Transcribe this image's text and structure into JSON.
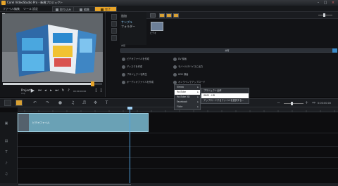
{
  "window": {
    "title": "Corel VideoStudio Pro - 新規プロジェクト"
  },
  "menubar": {
    "items": [
      "ファイル",
      "編集",
      "ツール",
      "設定"
    ]
  },
  "tabs": [
    {
      "label": "取り込み",
      "active": false
    },
    {
      "label": "編集",
      "active": false
    },
    {
      "label": "完了",
      "active": true
    }
  ],
  "player": {
    "project_label": "Project",
    "clip_label": "Clip",
    "timecode": "00:00:00:00"
  },
  "library": {
    "add_label": "追加",
    "nav_items": [
      "サンプル",
      "フォルダー"
    ],
    "thumb_label": "ビデオ",
    "path_label": "参照"
  },
  "share": {
    "header": "共有",
    "options": [
      "ビデオファイルを作成",
      "ディスクを作成",
      "プロジェクトを再生",
      "オーディオファイルを作成",
      "DV 録画",
      "モバイルデバイスに出力",
      "HDV 録画",
      "オンラインでアップロード"
    ]
  },
  "menus": {
    "main": [
      {
        "label": "Vimeo",
        "has_sub": true
      },
      {
        "label": "YouTube",
        "has_sub": true,
        "highlight": true
      },
      {
        "label": "YouTube 3D",
        "has_sub": true
      },
      {
        "label": "Facebook",
        "has_sub": true
      },
      {
        "label": "Flickr",
        "has_sub": true
      }
    ],
    "sub": [
      {
        "label": "プロジェクト全体"
      },
      {
        "label": "WMV - HD",
        "highlight": true
      },
      {
        "label": "アップロードするファイルを選択する..."
      }
    ]
  },
  "timeline": {
    "time_display": "0:00:00:00",
    "clip_name": "ビデオファイル"
  },
  "colors": {
    "accent": "#e8a428",
    "clip": "#6aa1b5",
    "playhead": "#4fa3e0"
  }
}
